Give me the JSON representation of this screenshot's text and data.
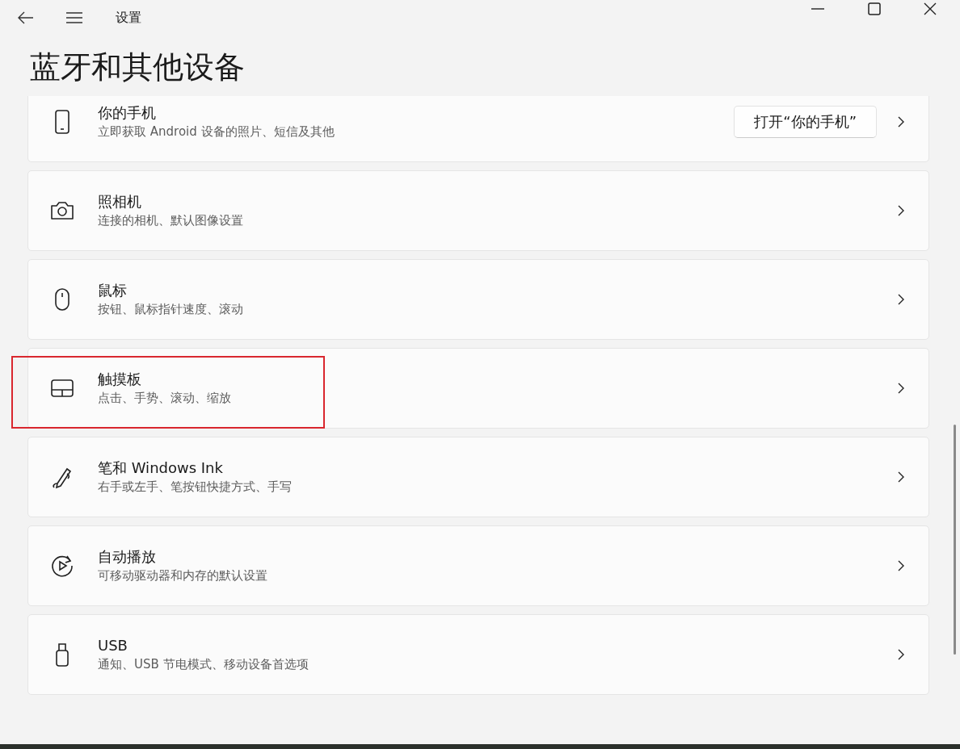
{
  "window": {
    "title": "设置"
  },
  "page": {
    "heading": "蓝牙和其他设备"
  },
  "items": [
    {
      "title": "你的手机",
      "subtitle": "立即获取 Android 设备的照片、短信及其他",
      "button": "打开“你的手机”",
      "highlighted": false
    },
    {
      "title": "照相机",
      "subtitle": "连接的相机、默认图像设置",
      "highlighted": false
    },
    {
      "title": "鼠标",
      "subtitle": "按钮、鼠标指针速度、滚动",
      "highlighted": false
    },
    {
      "title": "触摸板",
      "subtitle": "点击、手势、滚动、缩放",
      "highlighted": true
    },
    {
      "title": "笔和 Windows Ink",
      "subtitle": "右手或左手、笔按钮快捷方式、手写",
      "highlighted": false
    },
    {
      "title": "自动播放",
      "subtitle": "可移动驱动器和内存的默认设置",
      "highlighted": false
    },
    {
      "title": "USB",
      "subtitle": "通知、USB 节电模式、移动设备首选项",
      "highlighted": false
    }
  ]
}
